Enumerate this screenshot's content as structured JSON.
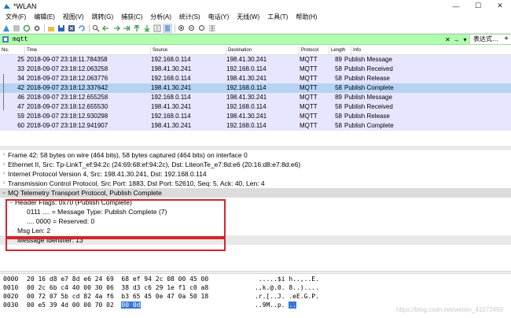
{
  "window": {
    "title": "*WLAN",
    "minimize": "—",
    "maximize": "☐",
    "close": "✕"
  },
  "menu": [
    "文件(F)",
    "编辑(E)",
    "视图(V)",
    "跳转(G)",
    "捕获(C)",
    "分析(A)",
    "统计(S)",
    "电话(Y)",
    "无线(W)",
    "工具(T)",
    "帮助(H)"
  ],
  "filter": {
    "value": "mqtt",
    "expression_label": "表达式…",
    "add_label": "+"
  },
  "packet_list": {
    "columns": [
      "No.",
      "Time",
      "Source",
      "Destination",
      "Protocol",
      "Length",
      "Info"
    ],
    "rows": [
      {
        "no": "25",
        "time": "2018-09-07 23:18:11.784358",
        "src": "192.168.0.114",
        "dst": "198.41.30.241",
        "proto": "MQTT",
        "len": "89",
        "info": "Publish Message"
      },
      {
        "no": "33",
        "time": "2018-09-07 23:18:12.063258",
        "src": "198.41.30.241",
        "dst": "192.168.0.114",
        "proto": "MQTT",
        "len": "58",
        "info": "Publish Received"
      },
      {
        "no": "34",
        "time": "2018-09-07 23:18:12.063776",
        "src": "192.168.0.114",
        "dst": "198.41.30.241",
        "proto": "MQTT",
        "len": "58",
        "info": "Publish Release"
      },
      {
        "no": "42",
        "time": "2018-09-07 23:18:12.337642",
        "src": "198.41.30.241",
        "dst": "192.168.0.114",
        "proto": "MQTT",
        "len": "58",
        "info": "Publish Complete"
      },
      {
        "no": "46",
        "time": "2018-09-07 23:18:12.655258",
        "src": "192.168.0.114",
        "dst": "198.41.30.241",
        "proto": "MQTT",
        "len": "89",
        "info": "Publish Message"
      },
      {
        "no": "47",
        "time": "2018-09-07 23:18:12.655530",
        "src": "198.41.30.241",
        "dst": "192.168.0.114",
        "proto": "MQTT",
        "len": "58",
        "info": "Publish Received"
      },
      {
        "no": "59",
        "time": "2018-09-07 23:18:12.930298",
        "src": "192.168.0.114",
        "dst": "198.41.30.241",
        "proto": "MQTT",
        "len": "58",
        "info": "Publish Release"
      },
      {
        "no": "60",
        "time": "2018-09-07 23:18:12.941907",
        "src": "198.41.30.241",
        "dst": "192.168.0.114",
        "proto": "MQTT",
        "len": "58",
        "info": "Publish Complete"
      }
    ]
  },
  "details": {
    "frame": "Frame 42: 58 bytes on wire (464 bits), 58 bytes captured (464 bits) on interface 0",
    "ethernet": "Ethernet II, Src: Tp-LinkT_ef:94:2c (24:69:68:ef:94:2c), Dst: LiteonTe_e7:8d:e6 (20:16:d8:e7:8d:e6)",
    "ip": "Internet Protocol Version 4, Src: 198.41.30.241, Dst: 192.168.0.114",
    "tcp": "Transmission Control Protocol, Src Port: 1883, Dst Port: 52610, Seq: 5, Ack: 40, Len: 4",
    "mqtt": "MQ Telemetry Transport Protocol, Publish Complete",
    "header_flags": "Header Flags: 0x70 (Publish Complete)",
    "msg_type": "0111 .... = Message Type: Publish Complete (7)",
    "reserved": ".... 0000 = Reserved: 0",
    "msg_len": "Msg Len: 2",
    "msg_id": "Message Identifier: 13"
  },
  "hex": {
    "rows": [
      {
        "offset": "0000",
        "bytes": "20 16 d8 e7 8d e6 24 69  68 ef 94 2c 08 00 45 00",
        "ascii": " .....$i h..,..E."
      },
      {
        "offset": "0010",
        "bytes": "00 2c 6b c4 40 00 30 06  38 d3 c6 29 1e f1 c0 a8",
        "ascii": ".,k.@.0. 8..)...."
      },
      {
        "offset": "0020",
        "bytes": "00 72 07 5b cd 82 4a f6  b3 65 45 0e 47 0a 50 18",
        "ascii": ".r.[..J. .eE.G.P."
      },
      {
        "offset": "0030",
        "bytes_plain": "00 e5 39 4d 00 00 70 02  ",
        "bytes_hl": "00 0d",
        "ascii_plain": "..9M..p. ",
        "ascii_hl": ".."
      }
    ]
  },
  "watermark": "https://blog.csdn.net/weixin_41572450"
}
